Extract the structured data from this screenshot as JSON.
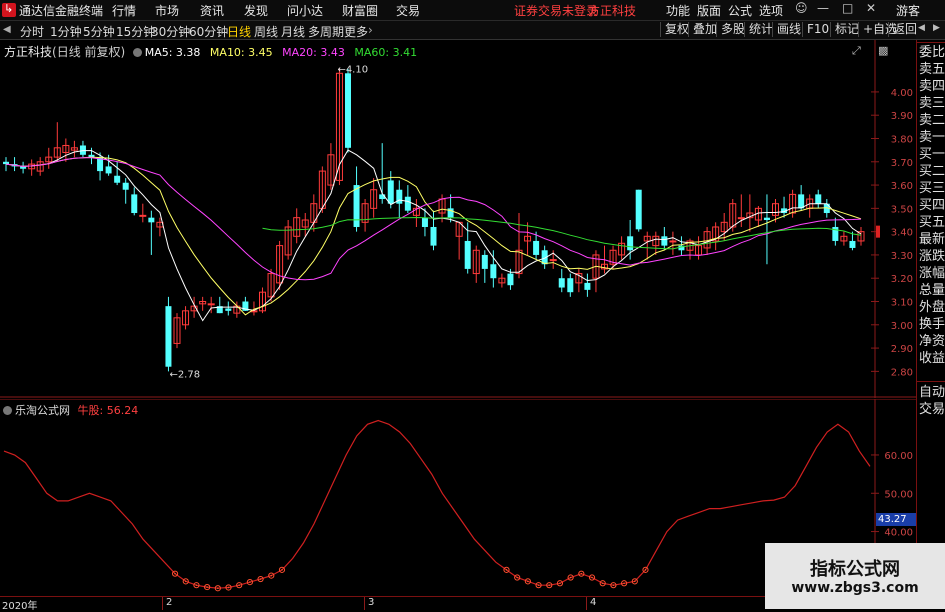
{
  "menubar": {
    "app_title": "通达信金融终端",
    "items": [
      "行情",
      "市场",
      "资讯",
      "发现",
      "问小达",
      "财富圈",
      "交易"
    ],
    "login_warning": "证券交易未登录",
    "broker": "方正科技",
    "right_items": [
      "功能",
      "版面",
      "公式",
      "选项"
    ],
    "guest": "游客"
  },
  "periodbar": {
    "periods": [
      "分时",
      "1分钟",
      "5分钟",
      "15分钟",
      "30分钟",
      "60分钟",
      "日线",
      "周线",
      "月线",
      "多周期",
      "更多"
    ],
    "active": "日线",
    "right_buttons": [
      "复权",
      "叠加",
      "多股",
      "统计",
      "画线",
      "F10",
      "标记",
      "+自选",
      "返回"
    ]
  },
  "main_chart": {
    "stock_name": "方正科技",
    "period_note": "(日线 前复权)",
    "ma_labels": [
      {
        "label": "MA5: 3.38",
        "color": "#ffffff"
      },
      {
        "label": "MA10: 3.45",
        "color": "#ffff66"
      },
      {
        "label": "MA20: 3.43",
        "color": "#ff44ff"
      },
      {
        "label": "MA60: 3.41",
        "color": "#33dd33"
      }
    ],
    "y_ticks": [
      "4.00",
      "3.90",
      "3.80",
      "3.70",
      "3.60",
      "3.50",
      "3.40",
      "3.30",
      "3.20",
      "3.10",
      "3.00",
      "2.90",
      "2.80"
    ],
    "high_label": "4.10",
    "low_label": "2.78",
    "current_price_tag": "3.40"
  },
  "indicator": {
    "name": "乐淘公式网",
    "value_label": "牛股: 56.24",
    "y_ticks": [
      "60.00",
      "50.00",
      "40.00"
    ],
    "current_tag": "43.27"
  },
  "right_panel": {
    "items": [
      "委比",
      "卖五",
      "卖四",
      "卖三",
      "卖二",
      "卖一",
      "买一",
      "买二",
      "买三",
      "买四",
      "买五",
      "最新",
      "涨跌",
      "涨幅",
      "总量",
      "外盘",
      "换手",
      "净资",
      "收益"
    ],
    "bottom_items": [
      "自动",
      "交易"
    ]
  },
  "date_axis": [
    "2020年",
    "2",
    "3",
    "4"
  ],
  "watermark": {
    "title": "指标公式网",
    "url": "www.zbgs3.com"
  },
  "colors": {
    "up": "#ff3b3b",
    "down": "#54ffff",
    "ma5": "#ffffff",
    "ma10": "#ffff66",
    "ma20": "#ff44ff",
    "ma60": "#33dd33",
    "indicator_line": "#d02020",
    "axis": "#8b1a1a"
  },
  "chart_data": {
    "type": "candlestick",
    "ylim": [
      2.72,
      4.18
    ],
    "candles": [
      [
        3.7,
        3.72,
        3.66,
        3.69
      ],
      [
        3.69,
        3.72,
        3.66,
        3.68
      ],
      [
        3.68,
        3.7,
        3.65,
        3.67
      ],
      [
        3.67,
        3.71,
        3.64,
        3.69
      ],
      [
        3.66,
        3.72,
        3.64,
        3.7
      ],
      [
        3.7,
        3.76,
        3.67,
        3.72
      ],
      [
        3.72,
        3.87,
        3.7,
        3.76
      ],
      [
        3.74,
        3.8,
        3.7,
        3.77
      ],
      [
        3.75,
        3.79,
        3.72,
        3.76
      ],
      [
        3.77,
        3.79,
        3.72,
        3.73
      ],
      [
        3.73,
        3.76,
        3.69,
        3.72
      ],
      [
        3.72,
        3.74,
        3.62,
        3.66
      ],
      [
        3.68,
        3.73,
        3.64,
        3.65
      ],
      [
        3.64,
        3.7,
        3.6,
        3.61
      ],
      [
        3.61,
        3.63,
        3.52,
        3.58
      ],
      [
        3.56,
        3.59,
        3.47,
        3.48
      ],
      [
        3.47,
        3.52,
        3.44,
        3.47
      ],
      [
        3.46,
        3.49,
        3.3,
        3.44
      ],
      [
        3.42,
        3.46,
        3.38,
        3.44
      ],
      [
        3.08,
        3.12,
        2.8,
        2.82
      ],
      [
        2.92,
        3.05,
        2.9,
        3.03
      ],
      [
        3.0,
        3.08,
        2.98,
        3.06
      ],
      [
        3.06,
        3.12,
        3.03,
        3.08
      ],
      [
        3.09,
        3.12,
        3.06,
        3.1
      ],
      [
        3.09,
        3.12,
        3.05,
        3.09
      ],
      [
        3.08,
        3.12,
        3.05,
        3.05
      ],
      [
        3.07,
        3.1,
        3.04,
        3.06
      ],
      [
        3.05,
        3.1,
        3.03,
        3.08
      ],
      [
        3.1,
        3.12,
        3.06,
        3.06
      ],
      [
        3.06,
        3.1,
        3.04,
        3.06
      ],
      [
        3.06,
        3.16,
        3.05,
        3.14
      ],
      [
        3.12,
        3.24,
        3.1,
        3.22
      ],
      [
        3.18,
        3.36,
        3.15,
        3.34
      ],
      [
        3.3,
        3.45,
        3.28,
        3.42
      ],
      [
        3.38,
        3.5,
        3.35,
        3.46
      ],
      [
        3.42,
        3.48,
        3.38,
        3.45
      ],
      [
        3.44,
        3.56,
        3.4,
        3.52
      ],
      [
        3.5,
        3.68,
        3.48,
        3.66
      ],
      [
        3.6,
        3.78,
        3.58,
        3.73
      ],
      [
        3.62,
        4.1,
        3.6,
        4.08
      ],
      [
        4.08,
        4.1,
        3.74,
        3.76
      ],
      [
        3.6,
        3.68,
        3.4,
        3.42
      ],
      [
        3.44,
        3.54,
        3.4,
        3.52
      ],
      [
        3.5,
        3.63,
        3.46,
        3.58
      ],
      [
        3.56,
        3.78,
        3.52,
        3.54
      ],
      [
        3.62,
        3.66,
        3.5,
        3.52
      ],
      [
        3.58,
        3.62,
        3.46,
        3.52
      ],
      [
        3.55,
        3.6,
        3.48,
        3.49
      ],
      [
        3.47,
        3.54,
        3.42,
        3.5
      ],
      [
        3.46,
        3.5,
        3.38,
        3.42
      ],
      [
        3.42,
        3.49,
        3.32,
        3.34
      ],
      [
        3.48,
        3.56,
        3.44,
        3.54
      ],
      [
        3.5,
        3.56,
        3.44,
        3.46
      ],
      [
        3.38,
        3.44,
        3.28,
        3.44
      ],
      [
        3.36,
        3.44,
        3.22,
        3.24
      ],
      [
        3.22,
        3.34,
        3.18,
        3.32
      ],
      [
        3.3,
        3.32,
        3.18,
        3.24
      ],
      [
        3.26,
        3.32,
        3.16,
        3.2
      ],
      [
        3.18,
        3.22,
        3.16,
        3.2
      ],
      [
        3.22,
        3.24,
        3.15,
        3.17
      ],
      [
        3.22,
        3.48,
        3.2,
        3.32
      ],
      [
        3.36,
        3.44,
        3.3,
        3.38
      ],
      [
        3.36,
        3.4,
        3.28,
        3.3
      ],
      [
        3.32,
        3.34,
        3.24,
        3.26
      ],
      [
        3.28,
        3.32,
        3.24,
        3.28
      ],
      [
        3.2,
        3.24,
        3.14,
        3.16
      ],
      [
        3.2,
        3.22,
        3.12,
        3.14
      ],
      [
        3.18,
        3.24,
        3.14,
        3.22
      ],
      [
        3.18,
        3.22,
        3.12,
        3.15
      ],
      [
        3.2,
        3.32,
        3.14,
        3.3
      ],
      [
        3.24,
        3.34,
        3.22,
        3.26
      ],
      [
        3.26,
        3.34,
        3.24,
        3.32
      ],
      [
        3.3,
        3.38,
        3.28,
        3.35
      ],
      [
        3.38,
        3.45,
        3.28,
        3.32
      ],
      [
        3.58,
        3.58,
        3.4,
        3.41
      ],
      [
        3.36,
        3.4,
        3.28,
        3.38
      ],
      [
        3.34,
        3.4,
        3.3,
        3.38
      ],
      [
        3.38,
        3.42,
        3.32,
        3.34
      ],
      [
        3.36,
        3.4,
        3.3,
        3.36
      ],
      [
        3.34,
        3.38,
        3.3,
        3.32
      ],
      [
        3.32,
        3.37,
        3.28,
        3.36
      ],
      [
        3.3,
        3.38,
        3.28,
        3.34
      ],
      [
        3.33,
        3.42,
        3.3,
        3.4
      ],
      [
        3.36,
        3.44,
        3.32,
        3.42
      ],
      [
        3.4,
        3.48,
        3.36,
        3.44
      ],
      [
        3.42,
        3.54,
        3.4,
        3.52
      ],
      [
        3.46,
        3.56,
        3.42,
        3.46
      ],
      [
        3.46,
        3.56,
        3.4,
        3.48
      ],
      [
        3.45,
        3.51,
        3.42,
        3.5
      ],
      [
        3.46,
        3.56,
        3.26,
        3.45
      ],
      [
        3.47,
        3.54,
        3.44,
        3.52
      ],
      [
        3.5,
        3.55,
        3.46,
        3.48
      ],
      [
        3.48,
        3.58,
        3.46,
        3.56
      ],
      [
        3.56,
        3.6,
        3.49,
        3.5
      ],
      [
        3.5,
        3.56,
        3.46,
        3.54
      ],
      [
        3.56,
        3.58,
        3.5,
        3.52
      ],
      [
        3.52,
        3.54,
        3.46,
        3.48
      ],
      [
        3.42,
        3.46,
        3.34,
        3.36
      ],
      [
        3.36,
        3.4,
        3.34,
        3.38
      ],
      [
        3.36,
        3.4,
        3.32,
        3.33
      ],
      [
        3.36,
        3.42,
        3.34,
        3.4
      ]
    ],
    "indicator": {
      "ylim": [
        25,
        72
      ],
      "values": [
        61,
        60,
        58,
        54,
        50,
        48,
        48,
        49,
        50,
        49,
        48,
        45,
        42,
        38,
        35,
        32,
        29,
        27,
        26,
        25.5,
        25.2,
        25.4,
        26,
        26.8,
        27.6,
        28.5,
        30,
        33,
        37,
        42,
        48,
        54,
        60,
        65,
        68,
        69,
        68,
        66,
        63,
        59,
        55,
        50,
        46,
        42,
        38,
        35,
        32,
        30,
        28,
        27,
        26,
        26,
        26.5,
        28,
        29,
        28,
        26.5,
        26,
        26.5,
        27,
        30,
        35,
        40,
        43,
        44,
        45,
        46,
        46,
        46.5,
        47,
        47.5,
        48,
        48.2,
        49,
        52,
        57,
        62,
        66,
        68,
        66,
        61,
        57
      ]
    }
  }
}
